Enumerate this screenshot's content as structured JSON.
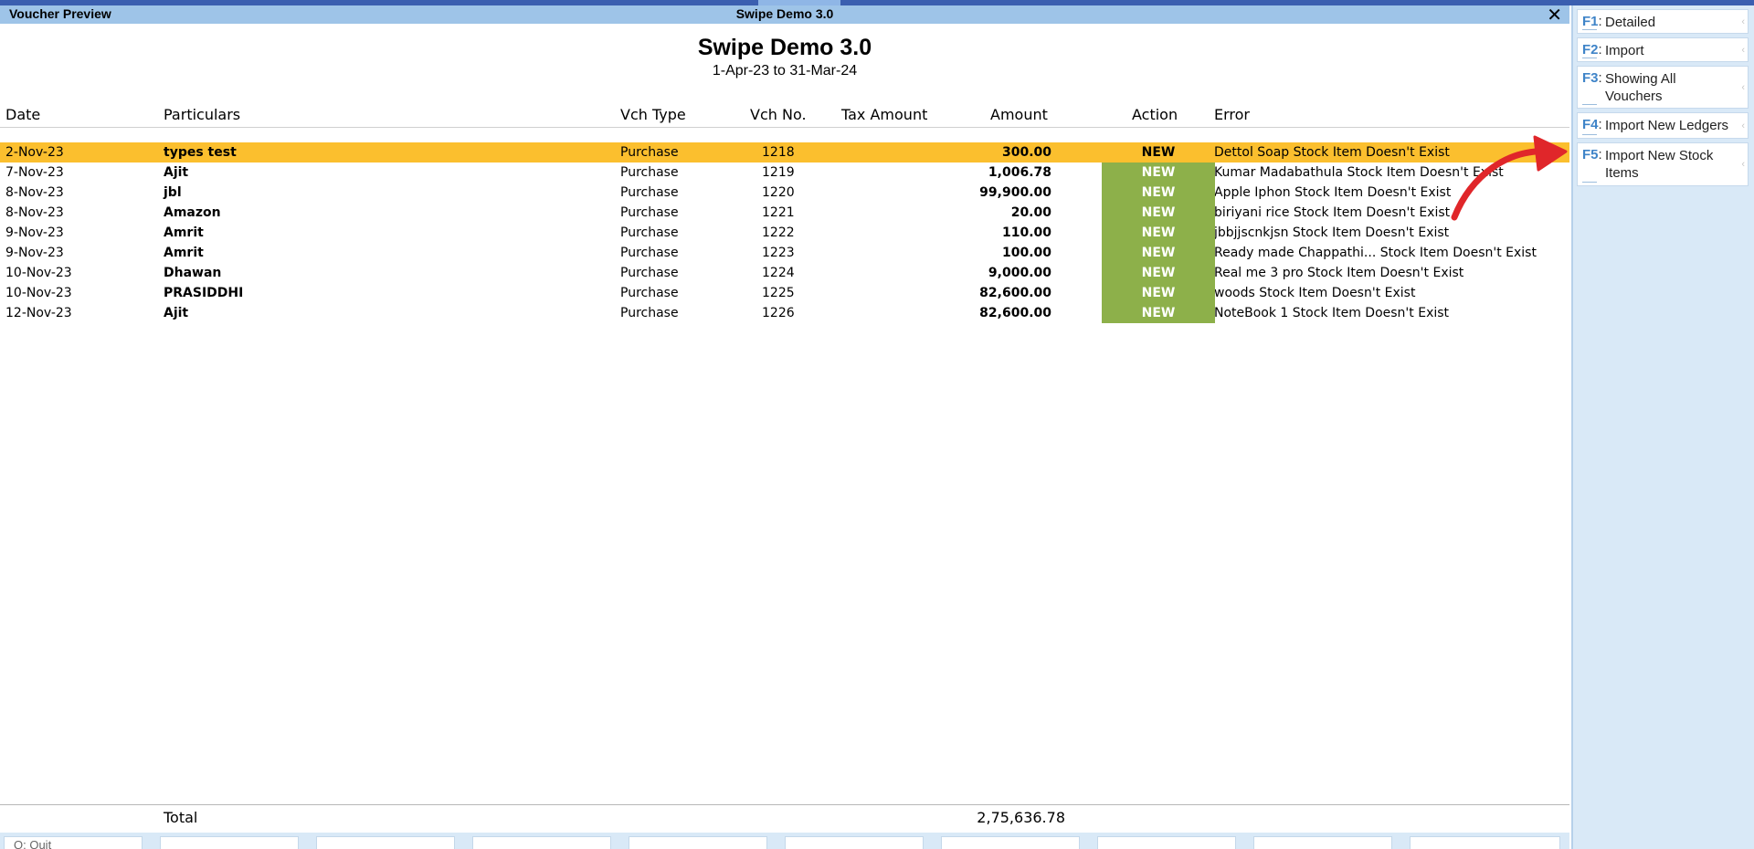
{
  "window": {
    "title_left": "Voucher Preview",
    "title_center": "Swipe Demo 3.0",
    "close_symbol": "✕"
  },
  "report": {
    "company": "Swipe Demo 3.0",
    "period": "1-Apr-23 to 31-Mar-24"
  },
  "columns": {
    "date": "Date",
    "particulars": "Particulars",
    "vch_type": "Vch Type",
    "vch_no": "Vch No.",
    "tax_amount": "Tax Amount",
    "amount": "Amount",
    "action": "Action",
    "error": "Error"
  },
  "rows": [
    {
      "date": "2-Nov-23",
      "particulars": "types test",
      "vch_type": "Purchase",
      "vch_no": "1218",
      "amount": "300.00",
      "action": "NEW",
      "error": "Dettol Soap Stock Item Doesn't Exist",
      "selected": true
    },
    {
      "date": "7-Nov-23",
      "particulars": "Ajit",
      "vch_type": "Purchase",
      "vch_no": "1219",
      "amount": "1,006.78",
      "action": "NEW",
      "error": "Kumar Madabathula Stock Item Doesn't Exist"
    },
    {
      "date": "8-Nov-23",
      "particulars": "jbl",
      "vch_type": "Purchase",
      "vch_no": "1220",
      "amount": "99,900.00",
      "action": "NEW",
      "error": "Apple Iphon Stock Item Doesn't Exist"
    },
    {
      "date": "8-Nov-23",
      "particulars": "Amazon",
      "vch_type": "Purchase",
      "vch_no": "1221",
      "amount": "20.00",
      "action": "NEW",
      "error": "biriyani rice Stock Item Doesn't Exist"
    },
    {
      "date": "9-Nov-23",
      "particulars": "Amrit",
      "vch_type": "Purchase",
      "vch_no": "1222",
      "amount": "110.00",
      "action": "NEW",
      "error": "jbbjjscnkjsn Stock Item Doesn't Exist"
    },
    {
      "date": "9-Nov-23",
      "particulars": "Amrit",
      "vch_type": "Purchase",
      "vch_no": "1223",
      "amount": "100.00",
      "action": "NEW",
      "error": "Ready made Chappathi... Stock Item Doesn't Exist"
    },
    {
      "date": "10-Nov-23",
      "particulars": "Dhawan",
      "vch_type": "Purchase",
      "vch_no": "1224",
      "amount": "9,000.00",
      "action": "NEW",
      "error": "Real me 3 pro Stock Item Doesn't Exist"
    },
    {
      "date": "10-Nov-23",
      "particulars": "PRASIDDHI",
      "vch_type": "Purchase",
      "vch_no": "1225",
      "amount": "82,600.00",
      "action": "NEW",
      "error": "woods Stock Item Doesn't Exist"
    },
    {
      "date": "12-Nov-23",
      "particulars": "Ajit",
      "vch_type": "Purchase",
      "vch_no": "1226",
      "amount": "82,600.00",
      "action": "NEW",
      "error": "NoteBook 1 Stock Item Doesn't Exist"
    }
  ],
  "total": {
    "label": "Total",
    "amount": "2,75,636.78"
  },
  "bottom_bar": {
    "quit_label": "Q: Quit"
  },
  "sidebar": {
    "buttons": [
      {
        "key": "F1",
        "label": "Detailed"
      },
      {
        "key": "F2",
        "label": "Import"
      },
      {
        "key": "F3",
        "label": "Showing All Vouchers"
      },
      {
        "key": "F4",
        "label": "Import New Ledgers"
      },
      {
        "key": "F5",
        "label": "Import New Stock Items"
      }
    ]
  },
  "colors": {
    "title_bar": "#9ec4e8",
    "selected_row": "#fbbf2e",
    "action_cell": "#8db04a",
    "sidebar_bg": "#d9e9f7",
    "function_key": "#3f84c8",
    "annotation_arrow": "#e0262a"
  }
}
